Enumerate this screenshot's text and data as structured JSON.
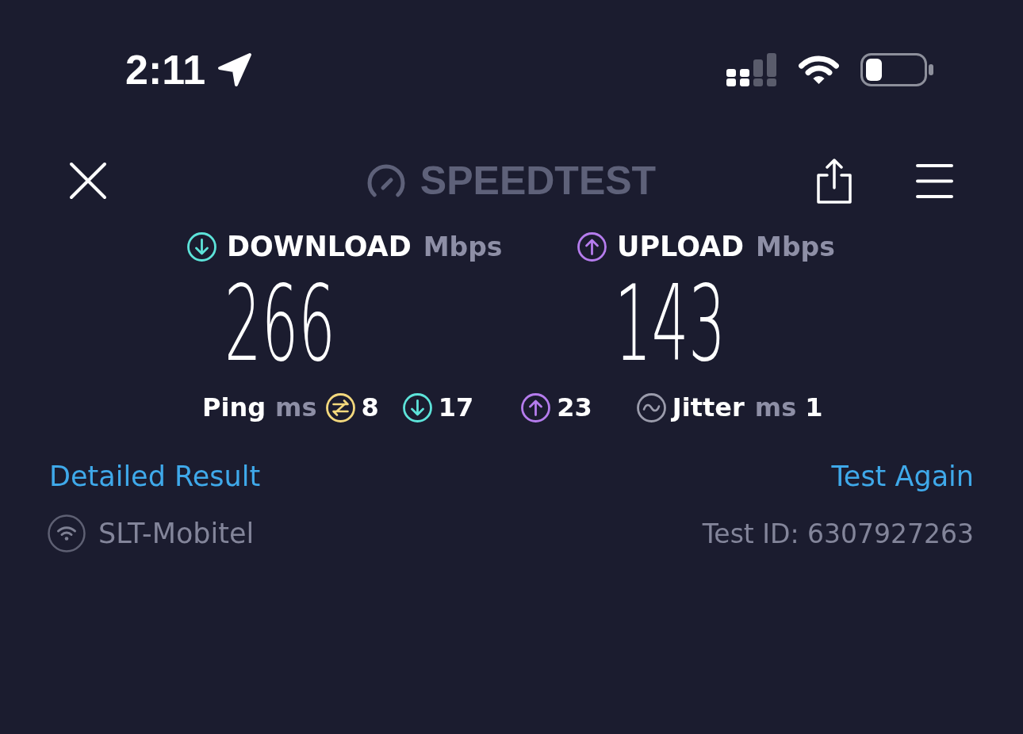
{
  "status_bar": {
    "time": "2:11"
  },
  "header": {
    "logo": "SPEEDTEST"
  },
  "results": [
    {
      "kind": "download",
      "label": "DOWNLOAD",
      "unit": "Mbps",
      "value": "266"
    },
    {
      "kind": "upload",
      "label": "UPLOAD",
      "unit": "Mbps",
      "value": "143"
    }
  ],
  "ping": {
    "label": "Ping",
    "unit": "ms",
    "metrics": [
      {
        "kind": "idle",
        "value": "8"
      },
      {
        "kind": "download",
        "value": "17"
      },
      {
        "kind": "upload",
        "value": "23"
      }
    ]
  },
  "jitter": {
    "label": "Jitter",
    "unit": "ms",
    "value": "1"
  },
  "links": {
    "detailed_result": "Detailed Result",
    "test_again": "Test Again"
  },
  "connection": {
    "provider": "SLT-Mobitel",
    "test_id": "Test ID: 6307927263"
  }
}
